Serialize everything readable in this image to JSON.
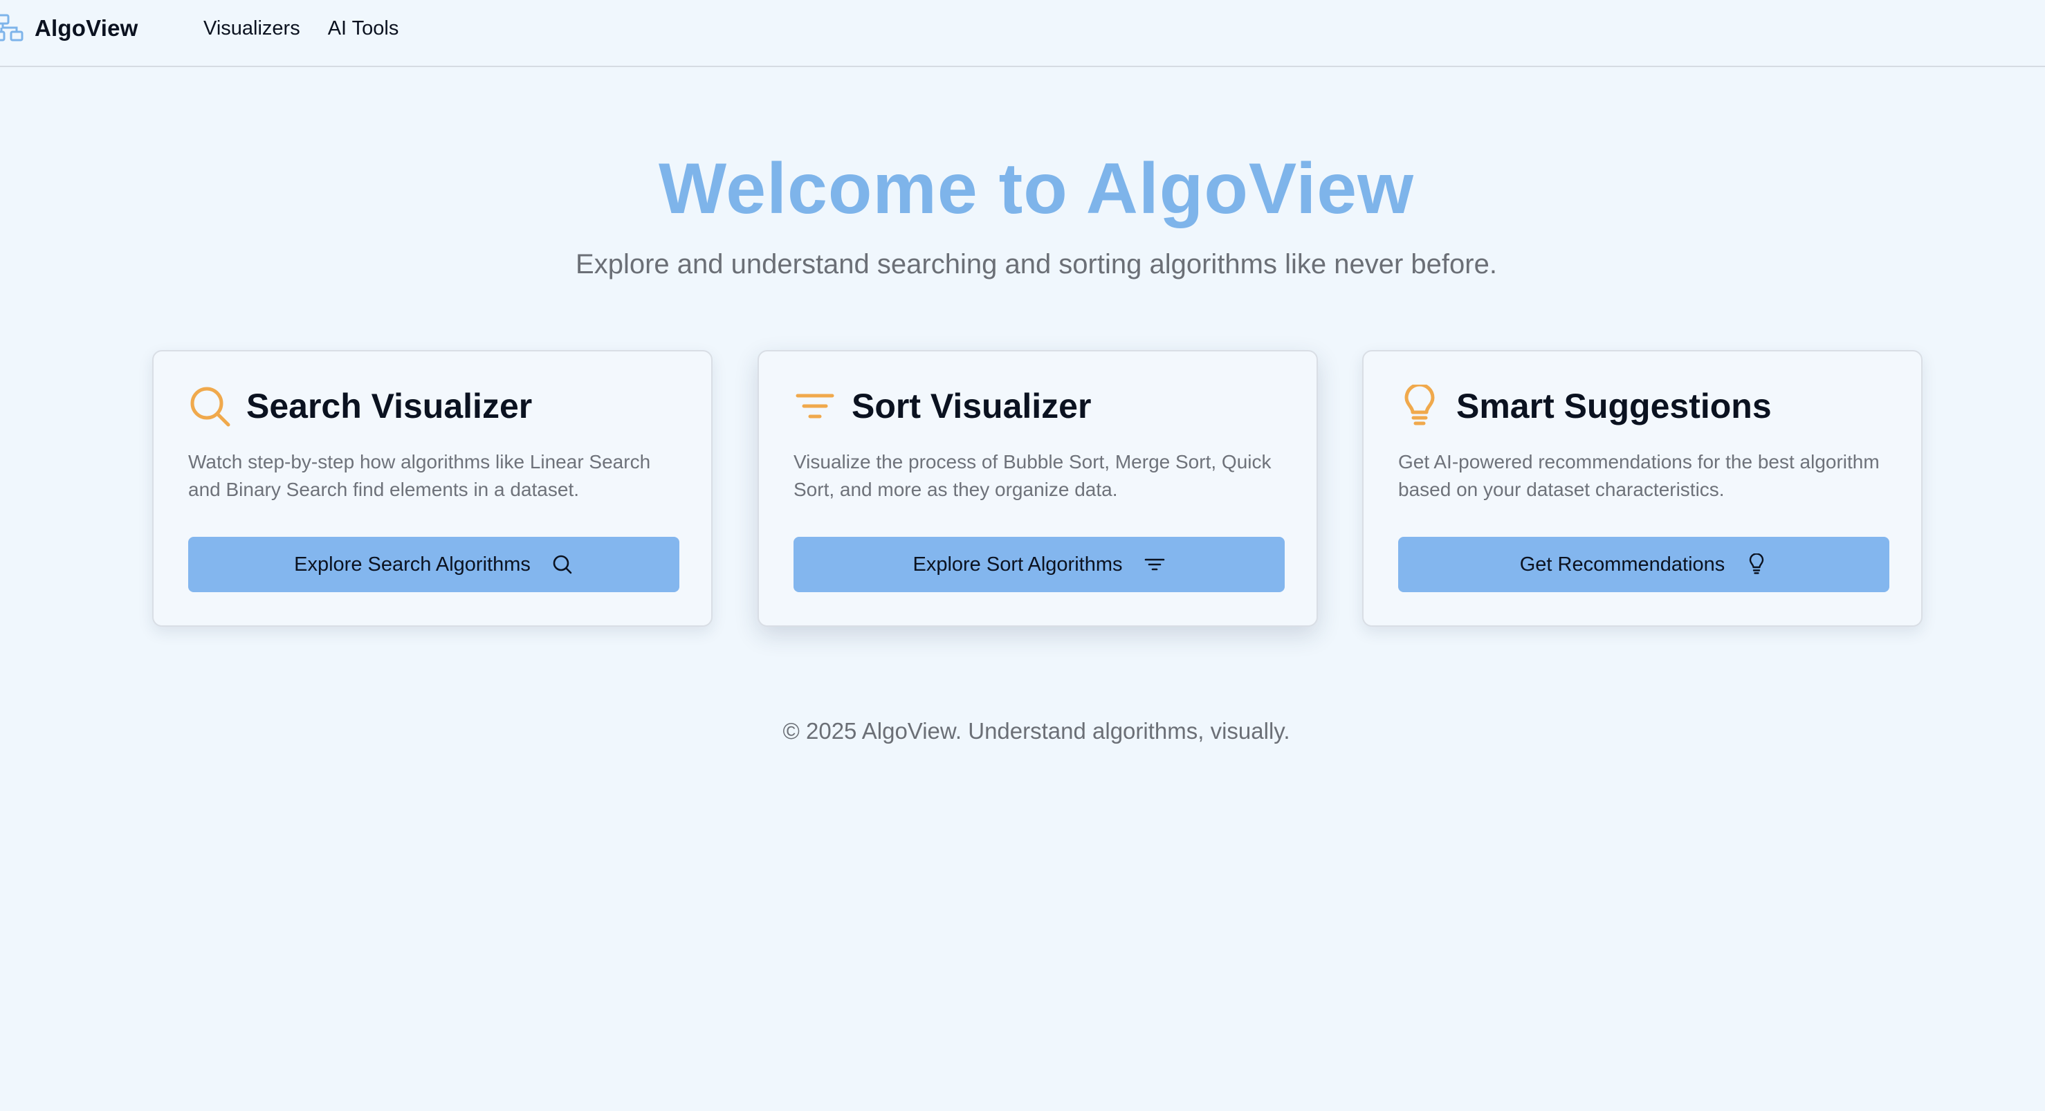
{
  "header": {
    "brand": "AlgoView",
    "nav": [
      {
        "label": "Visualizers"
      },
      {
        "label": "AI Tools"
      }
    ]
  },
  "hero": {
    "title": "Welcome to AlgoView",
    "subtitle": "Explore and understand searching and sorting algorithms like never before."
  },
  "cards": [
    {
      "icon": "search-icon",
      "title": "Search Visualizer",
      "description": "Watch step-by-step how algorithms like Linear Search and Binary Search find elements in a dataset.",
      "button_label": "Explore Search Algorithms",
      "button_icon": "search-icon"
    },
    {
      "icon": "filter-lines-icon",
      "title": "Sort Visualizer",
      "description": "Visualize the process of Bubble Sort, Merge Sort, Quick Sort, and more as they organize data.",
      "button_label": "Explore Sort Algorithms",
      "button_icon": "filter-lines-icon"
    },
    {
      "icon": "lightbulb-icon",
      "title": "Smart Suggestions",
      "description": "Get AI-powered recommendations for the best algorithm based on your dataset characteristics.",
      "button_label": "Get Recommendations",
      "button_icon": "lightbulb-icon"
    }
  ],
  "footer": {
    "text": "© 2025 AlgoView. Understand algorithms, visually."
  },
  "colors": {
    "background": "#f0f7fd",
    "accent_blue": "#7eb4ea",
    "button_blue": "#83b6ee",
    "icon_orange": "#f0a94c",
    "muted_text": "#6b6f76"
  }
}
